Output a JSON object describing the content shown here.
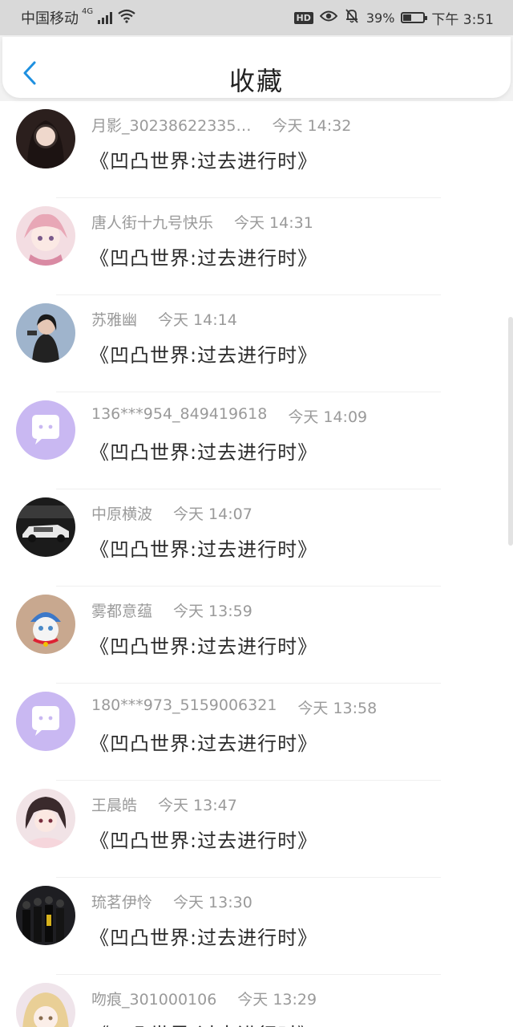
{
  "status_bar": {
    "carrier": "中国移动",
    "network": "4G",
    "hd": "HD",
    "battery_percent": "39%",
    "battery_level": 0.39,
    "time": "下午 3:51",
    "icons": [
      "signal-icon",
      "wifi-icon",
      "eye-icon",
      "mute-bell-icon",
      "battery-icon"
    ]
  },
  "header": {
    "title": "收藏",
    "back_icon": "chevron-left-icon",
    "accent": "#1e90e0"
  },
  "favorites": [
    {
      "user": "月影_30238622335…",
      "time": "今天 14:32",
      "title": "《凹凸世界:过去进行时》",
      "avatar": "photo-girl-dark-hair"
    },
    {
      "user": "唐人街十九号快乐",
      "time": "今天 14:31",
      "title": "《凹凸世界:过去进行时》",
      "avatar": "anime-girl-pink"
    },
    {
      "user": "苏雅幽",
      "time": "今天 14:14",
      "title": "《凹凸世界:过去进行时》",
      "avatar": "photo-girl"
    },
    {
      "user": "136***954_849419618",
      "time": "今天 14:09",
      "title": "《凹凸世界:过去进行时》",
      "avatar": "default-chat-icon"
    },
    {
      "user": "中原横波",
      "time": "今天 14:07",
      "title": "《凹凸世界:过去进行时》",
      "avatar": "photo-car"
    },
    {
      "user": "雾都意蕴",
      "time": "今天 13:59",
      "title": "《凹凸世界:过去进行时》",
      "avatar": "photo-cat"
    },
    {
      "user": "180***973_5159006321",
      "time": "今天 13:58",
      "title": "《凹凸世界:过去进行时》",
      "avatar": "default-chat-icon"
    },
    {
      "user": "王晨皓",
      "time": "今天 13:47",
      "title": "《凹凸世界:过去进行时》",
      "avatar": "anime-girl-dark"
    },
    {
      "user": "琉茗伊怜",
      "time": "今天 13:30",
      "title": "《凹凸世界:过去进行时》",
      "avatar": "photo-group"
    },
    {
      "user": "吻痕_301000106",
      "time": "今天 13:29",
      "title": "《凹凸世界:过去进行时》",
      "avatar": "anime-girl-blonde"
    }
  ]
}
